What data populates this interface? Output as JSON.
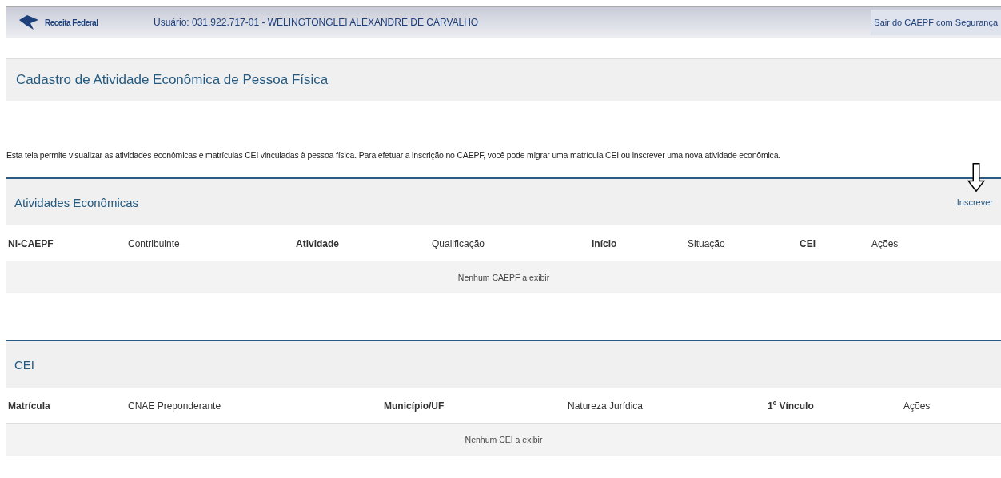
{
  "header": {
    "logo_text": "Receita Federal",
    "user": "Usuário: 031.922.717-01 - WELINGTONGLEI ALEXANDRE DE CARVALHO",
    "logout": "Sair do CAEPF com Segurança"
  },
  "page_title": "Cadastro de Atividade Econômica de Pessoa Física",
  "description": "Esta tela permite visualizar as atividades econômicas e matrículas CEI vinculadas à pessoa física. Para efetuar a inscrição no CAEPF, você pode migrar uma matrícula CEI ou inscrever uma nova atividade econômica.",
  "sections": [
    {
      "title": "Atividades Econômicas",
      "action": "Inscrever",
      "columns": [
        "NI-CAEPF",
        "Contribuinte",
        "Atividade",
        "Qualificação",
        "Início",
        "Situação",
        "CEI",
        "Ações"
      ],
      "empty_message": "Nenhum CAEPF a exibir"
    },
    {
      "title": "CEI",
      "columns": [
        "Matrícula",
        "CNAE Preponderante",
        "Município/UF",
        "Natureza Jurídica",
        "1º Vínculo",
        "Ações"
      ],
      "empty_message": "Nenhum CEI a exibir"
    }
  ]
}
